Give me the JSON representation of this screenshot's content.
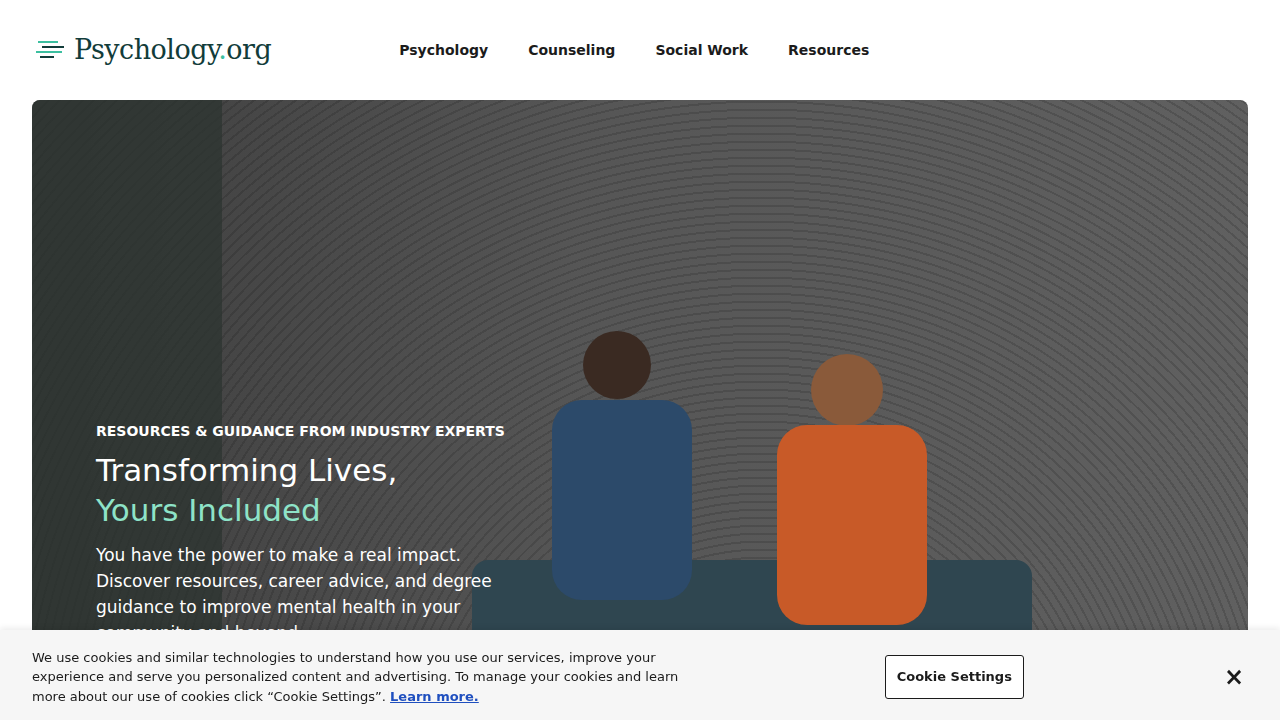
{
  "logo": {
    "name": "Psychology",
    "dot": ".",
    "tld": "org"
  },
  "nav": [
    {
      "label": "Psychology"
    },
    {
      "label": "Counseling"
    },
    {
      "label": "Social Work"
    },
    {
      "label": "Resources"
    }
  ],
  "hero": {
    "eyebrow": "RESOURCES & GUIDANCE FROM INDUSTRY EXPERTS",
    "title_line1": "Transforming Lives,",
    "title_line2": "Yours Included",
    "body": "You have the power to make a real impact. Discover resources, career advice, and degree guidance to improve mental health in your community and beyond"
  },
  "cookie_banner": {
    "text": "We use cookies and similar technologies to understand how you use our services, improve your experience and serve you personalized content and advertising. To manage your cookies and learn more about our use of cookies click “Cookie Settings”.",
    "link": "Learn more.",
    "button": "Cookie Settings",
    "close": "×"
  }
}
